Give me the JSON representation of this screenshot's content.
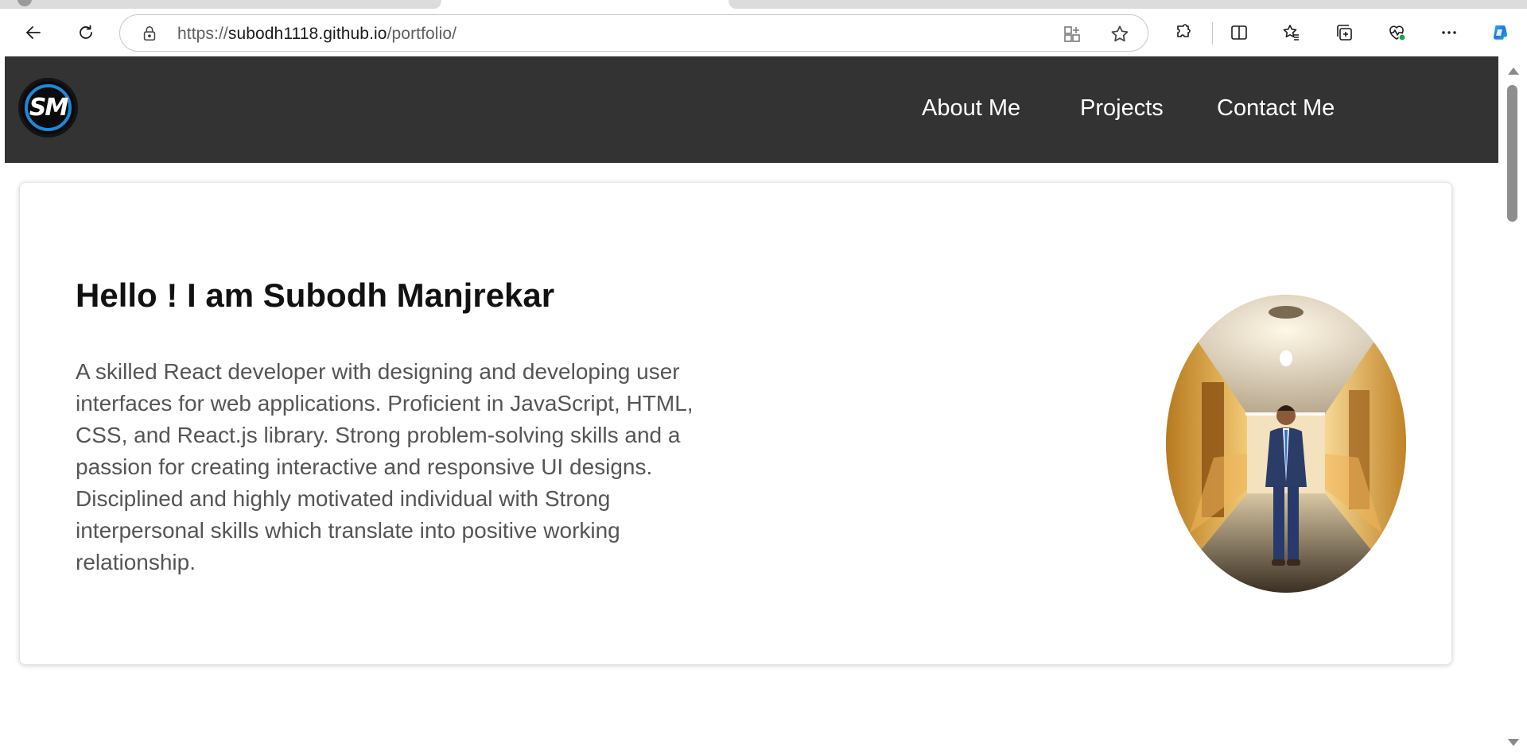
{
  "browser": {
    "url_scheme": "https://",
    "url_host": "subodh1118.github.io",
    "url_path": "/portfolio/",
    "toolbar_icons": [
      "back-icon",
      "refresh-icon",
      "lock-icon",
      "app-available-icon",
      "favorite-star-icon",
      "extensions-icon",
      "split-screen-icon",
      "favorites-icon",
      "collections-icon",
      "browser-essentials-icon",
      "more-icon",
      "copilot-icon"
    ]
  },
  "navbar": {
    "logo_text": "SM",
    "links": [
      {
        "label": "About Me"
      },
      {
        "label": "Projects"
      },
      {
        "label": "Contact Me"
      }
    ],
    "background": "#333333"
  },
  "hero": {
    "title": "Hello ! I am Subodh Manjrekar",
    "description": "A skilled React developer with designing and developing user interfaces for web applications. Proficient in JavaScript, HTML, CSS, and React.js library. Strong problem-solving skills and a passion for creating interactive and responsive UI designs. Disciplined and highly motivated individual with Strong interpersonal skills which translate into positive working relationship.",
    "portrait_alt": "profile-photo"
  },
  "colors": {
    "logo_ring": "#1e88d8",
    "text_dark": "#111111",
    "text_muted": "#555555"
  }
}
